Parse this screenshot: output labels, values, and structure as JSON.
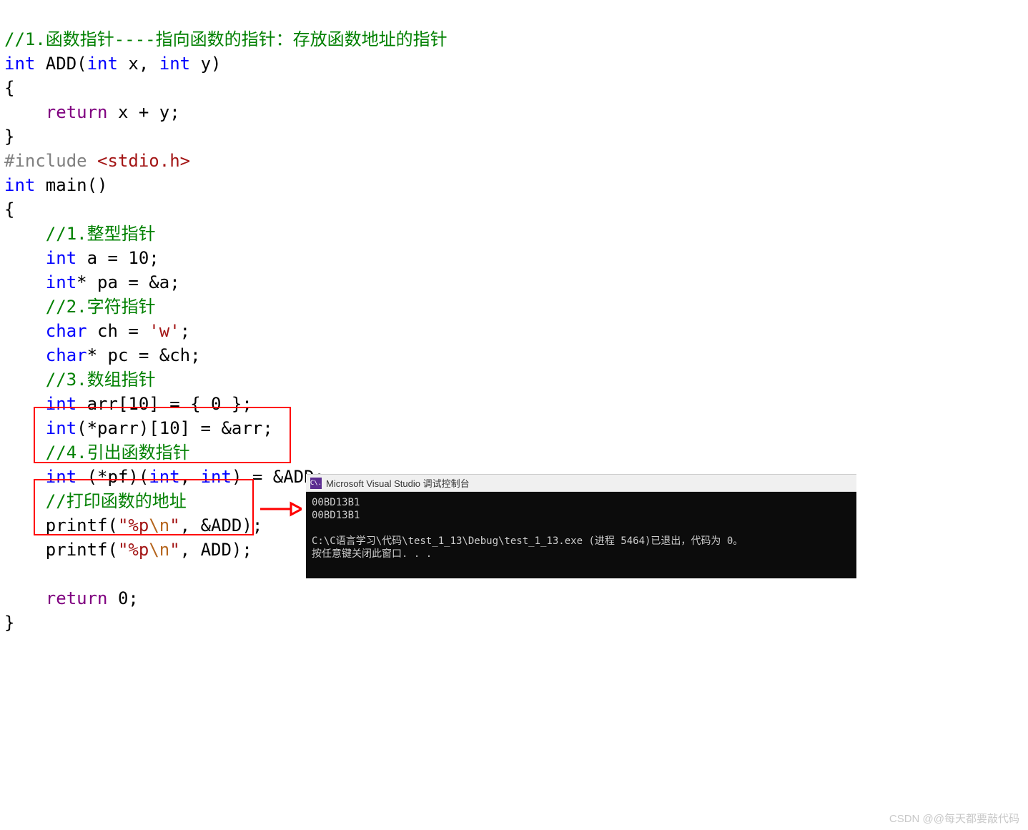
{
  "code": {
    "l1": "//1.函数指针----指向函数的指针：存放函数地址的指针",
    "l2_int": "int",
    "l2_add": " ADD",
    "l2_p1": "(",
    "l2_int2": "int",
    "l2_x": " x",
    "l2_c": ", ",
    "l2_int3": "int",
    "l2_y": " y",
    "l2_p2": ")",
    "l3": "{",
    "l4_ret": "    return",
    "l4_expr": " x + y;",
    "l5": "}",
    "l6_inc": "#include ",
    "l6_hdr": "<stdio.h>",
    "l7_int": "int",
    "l7_main": " main",
    "l7_p": "()",
    "l8": "{",
    "l9": "    //1.整型指针",
    "l10_int": "    int",
    "l10_rest": " a = 10;",
    "l11_int": "    int",
    "l11_rest": "* pa = &a;",
    "l12": "    //2.字符指针",
    "l13_char": "    char",
    "l13_mid": " ch = ",
    "l13_lit": "'w'",
    "l13_end": ";",
    "l14_char": "    char",
    "l14_rest": "* pc = &ch;",
    "l15": "    //3.数组指针",
    "l16_int": "    int",
    "l16_rest": " arr[10] = { 0 };",
    "l17_int": "    int",
    "l17_rest": "(*parr)[10] = &arr;",
    "l18": "    //4.引出函数指针",
    "l19_int": "    int",
    "l19_a": " (*pf)(",
    "l19_int2": "int",
    "l19_c": ", ",
    "l19_int3": "int",
    "l19_b": ") = &",
    "l19_add": "ADD",
    "l19_e": ";",
    "l20": "    //打印函数的地址",
    "l21_a": "    printf(",
    "l21_s1": "\"%p",
    "l21_esc": "\\n",
    "l21_s2": "\"",
    "l21_b": ", &ADD);",
    "l22_a": "    printf(",
    "l22_s1": "\"%p",
    "l22_esc": "\\n",
    "l22_s2": "\"",
    "l22_b": ", ADD);",
    "l23": " ",
    "l24_ret": "    return",
    "l24_v": " 0;",
    "l25": "}"
  },
  "console": {
    "icon": "C\\.",
    "title": "Microsoft Visual Studio 调试控制台",
    "line1": "00BD13B1",
    "line2": "00BD13B1",
    "line3": "",
    "line4": "C:\\C语言学习\\代码\\test_1_13\\Debug\\test_1_13.exe (进程 5464)已退出，代码为 0。",
    "line5": "按任意键关闭此窗口. . ."
  },
  "watermark": "CSDN @@每天都要敲代码"
}
